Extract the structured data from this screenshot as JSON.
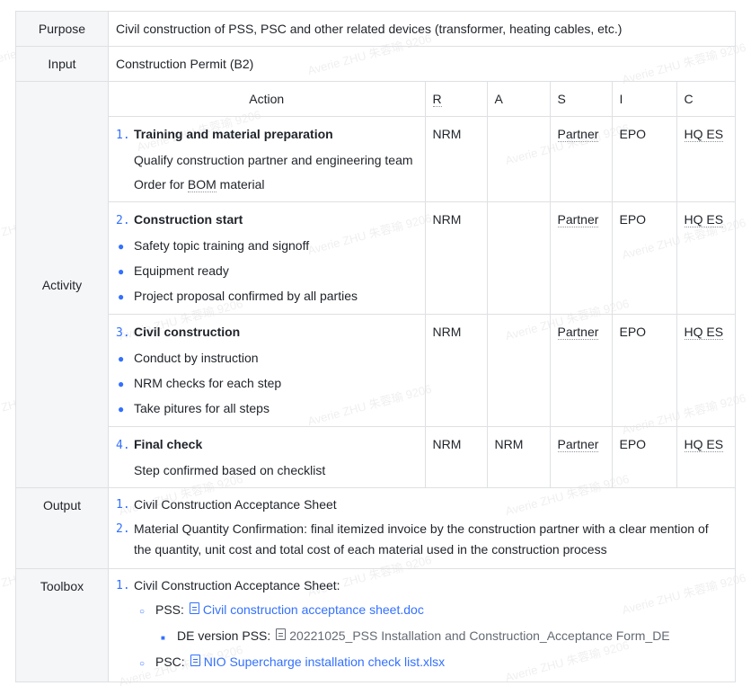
{
  "rows": {
    "purpose": {
      "label": "Purpose",
      "text": "Civil construction of PSS, PSC and other related devices (transformer, heating cables, etc.)"
    },
    "input": {
      "label": "Input",
      "text": "Construction Permit (B2)"
    },
    "activity": {
      "label": "Activity",
      "headers": [
        "Action",
        "R",
        "A",
        "S",
        "I",
        "C"
      ],
      "steps": [
        {
          "num": "1.",
          "title": "Training and material preparation",
          "lines": [
            "Qualify construction partner and engineering team"
          ],
          "line_bom_prefix": "Order for ",
          "line_bom_term": "BOM",
          "line_bom_suffix": " material",
          "r": "NRM",
          "a": "",
          "s": "Partner",
          "i": "EPO",
          "c": "HQ ES"
        },
        {
          "num": "2.",
          "title": "Construction start",
          "bullets": [
            "Safety topic training and signoff",
            "Equipment ready",
            "Project proposal confirmed by all parties"
          ],
          "r": "NRM",
          "a": "",
          "s": "Partner",
          "i": "EPO",
          "c": "HQ ES"
        },
        {
          "num": "3.",
          "title": "Civil construction",
          "bullets": [
            "Conduct by instruction",
            "NRM checks for each step",
            "Take pitures for all steps"
          ],
          "r": "NRM",
          "a": "",
          "s": "Partner",
          "i": "EPO",
          "c": "HQ ES"
        },
        {
          "num": "4.",
          "title": "Final check",
          "lines": [
            "Step confirmed based on checklist"
          ],
          "r": "NRM",
          "a": "NRM",
          "s": "Partner",
          "i": "EPO",
          "c": "HQ ES"
        }
      ]
    },
    "output": {
      "label": "Output",
      "items": [
        {
          "num": "1.",
          "text": "Civil Construction Acceptance Sheet"
        },
        {
          "num": "2.",
          "text": "Material Quantity Confirmation: final itemized invoice by the construction partner with a clear mention of the quantity, unit cost and total cost of each material used in the construction process"
        }
      ]
    },
    "toolbox": {
      "label": "Toolbox",
      "item1": "Civil Construction Acceptance Sheet:",
      "num1": "1.",
      "pss_label": "PSS:",
      "pss_link": "Civil construction acceptance sheet.doc",
      "de_label": "DE version PSS:",
      "de_doc": "20221025_PSS Installation and Construction_Acceptance Form_DE",
      "psc_label": "PSC:",
      "psc_link": "NIO Supercharge installation check list.xlsx"
    }
  },
  "watermark": "Averie ZHU 朱蓉瑜 9206"
}
